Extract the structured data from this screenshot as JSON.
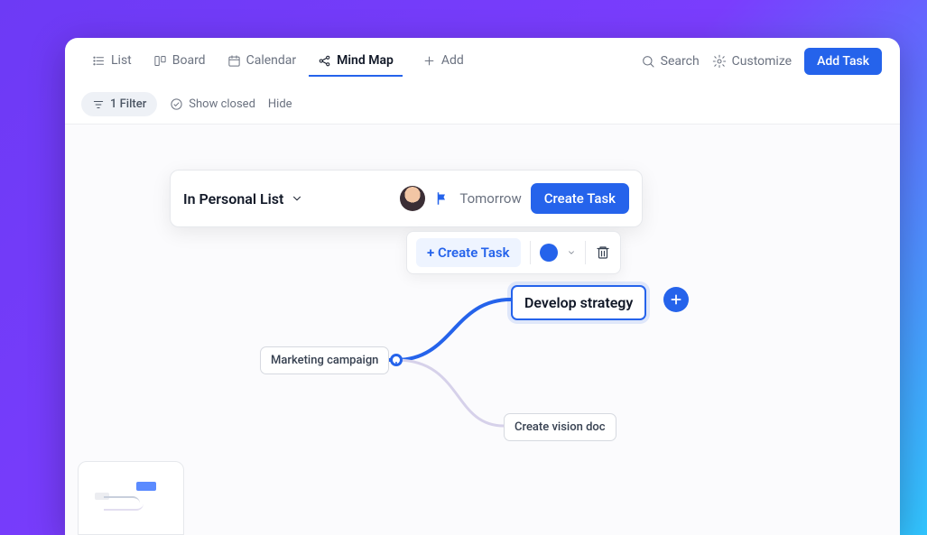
{
  "tabs": {
    "list": {
      "label": "List"
    },
    "board": {
      "label": "Board"
    },
    "calendar": {
      "label": "Calendar"
    },
    "mindmap": {
      "label": "Mind Map"
    },
    "add": {
      "label": "Add"
    }
  },
  "toolbar": {
    "search": "Search",
    "customize": "Customize",
    "add_task": "Add Task"
  },
  "filters": {
    "count_label": "1 Filter",
    "show_closed": "Show closed",
    "hide": "Hide"
  },
  "task_card": {
    "list_label": "In Personal List",
    "due_label": "Tomorrow",
    "create_label": "Create Task"
  },
  "node_toolbar": {
    "create_label": "+ Create Task",
    "color": "#2563eb"
  },
  "nodes": {
    "root": {
      "label": "Marketing campaign"
    },
    "strategy": {
      "label": "Develop strategy"
    },
    "vision": {
      "label": "Create vision doc"
    }
  }
}
